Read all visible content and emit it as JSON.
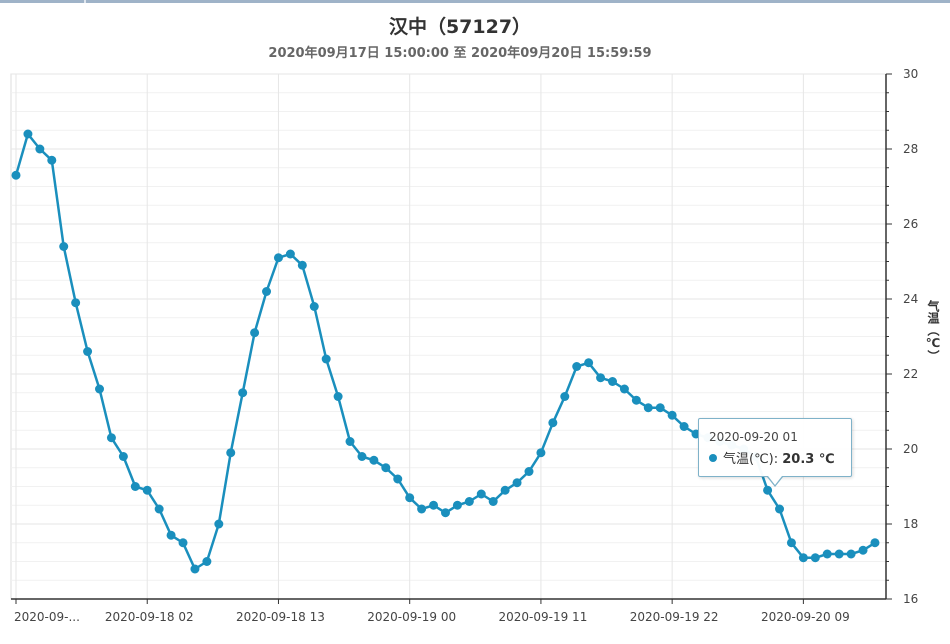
{
  "header": {
    "title": "汉中（57127）",
    "subtitle": "2020年09月17日 15:00:00 至 2020年09月20日 15:59:59"
  },
  "colors": {
    "series": "#1a8fbd",
    "grid": "#e6e6e6",
    "axis": "#333333"
  },
  "tooltip": {
    "date": "2020-09-20 01",
    "series_label": "气温(℃):",
    "value": "20.3 ℃"
  },
  "chart_data": {
    "type": "line",
    "ylabel": "气温（℃）",
    "ylim": [
      16,
      30
    ],
    "yticks": [
      16,
      18,
      20,
      22,
      24,
      26,
      28,
      30
    ],
    "y_axis_position": "right",
    "grid": true,
    "x_start": "2020-09-17 15",
    "x_step": "1 hour",
    "x_tick_labels": [
      {
        "index": 0,
        "label": "2020-09-..."
      },
      {
        "index": 11,
        "label": "2020-09-18 02"
      },
      {
        "index": 22,
        "label": "2020-09-18 13"
      },
      {
        "index": 33,
        "label": "2020-09-19 00"
      },
      {
        "index": 44,
        "label": "2020-09-19 11"
      },
      {
        "index": 55,
        "label": "2020-09-19 22"
      },
      {
        "index": 66,
        "label": "2020-09-20 09"
      }
    ],
    "series": [
      {
        "name": "气温(℃)",
        "values": [
          27.3,
          28.4,
          28.0,
          27.7,
          25.4,
          23.9,
          22.6,
          21.6,
          20.3,
          19.8,
          19.0,
          18.9,
          18.4,
          17.7,
          17.5,
          16.8,
          17.0,
          18.0,
          19.9,
          21.5,
          23.1,
          24.2,
          25.1,
          25.2,
          24.9,
          23.8,
          22.4,
          21.4,
          20.2,
          19.8,
          19.7,
          19.5,
          19.2,
          18.7,
          18.4,
          18.5,
          18.3,
          18.5,
          18.6,
          18.8,
          18.6,
          18.9,
          19.1,
          19.4,
          19.9,
          20.7,
          21.4,
          22.2,
          22.3,
          21.9,
          21.8,
          21.6,
          21.3,
          21.1,
          21.1,
          20.9,
          20.6,
          20.4,
          20.3,
          20.2,
          20.1,
          20.0,
          19.8,
          18.9,
          18.4,
          17.5,
          17.1,
          17.1,
          17.2,
          17.2,
          17.2,
          17.3,
          17.5
        ]
      }
    ]
  }
}
